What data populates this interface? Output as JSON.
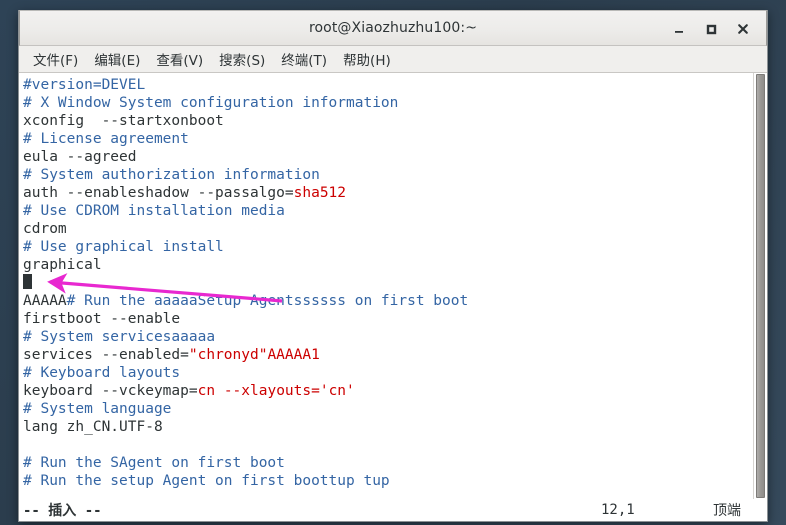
{
  "window": {
    "title": "root@Xiaozhuzhu100:~",
    "controls": [
      {
        "name": "minimize-button",
        "glyph": "minimize"
      },
      {
        "name": "maximize-button",
        "glyph": "maximize"
      },
      {
        "name": "close-button",
        "glyph": "close"
      }
    ]
  },
  "menubar": {
    "items": [
      {
        "label": "文件(F)"
      },
      {
        "label": "编辑(E)"
      },
      {
        "label": "查看(V)"
      },
      {
        "label": "搜索(S)"
      },
      {
        "label": "终端(T)"
      },
      {
        "label": "帮助(H)"
      }
    ]
  },
  "terminal": {
    "lines": [
      {
        "segments": [
          {
            "text": "#version=DEVEL",
            "style": "cmt"
          }
        ]
      },
      {
        "segments": [
          {
            "text": "# X Window System configuration information",
            "style": "cmt"
          }
        ]
      },
      {
        "segments": [
          {
            "text": "xconfig  --startxonboot",
            "style": "norm"
          }
        ]
      },
      {
        "segments": [
          {
            "text": "# License agreement",
            "style": "cmt"
          }
        ]
      },
      {
        "segments": [
          {
            "text": "eula --agreed",
            "style": "norm"
          }
        ]
      },
      {
        "segments": [
          {
            "text": "# System authorization information",
            "style": "cmt"
          }
        ]
      },
      {
        "segments": [
          {
            "text": "auth --enableshadow --passalgo=",
            "style": "norm"
          },
          {
            "text": "sha512",
            "style": "red"
          }
        ]
      },
      {
        "segments": [
          {
            "text": "# Use CDROM installation media",
            "style": "cmt"
          }
        ]
      },
      {
        "segments": [
          {
            "text": "cdrom",
            "style": "norm"
          }
        ]
      },
      {
        "segments": [
          {
            "text": "# Use graphical install",
            "style": "cmt"
          }
        ]
      },
      {
        "segments": [
          {
            "text": "graphical",
            "style": "norm"
          }
        ]
      },
      {
        "segments": [
          {
            "text": "",
            "style": "cursor"
          }
        ]
      },
      {
        "segments": [
          {
            "text": "AAAAA",
            "style": "norm"
          },
          {
            "text": "# Run the aaaaaSetup Agentssssss on first boot",
            "style": "cmt"
          }
        ]
      },
      {
        "segments": [
          {
            "text": "firstboot --enable",
            "style": "norm"
          }
        ]
      },
      {
        "segments": [
          {
            "text": "# System servicesaaaaa",
            "style": "cmt"
          }
        ]
      },
      {
        "segments": [
          {
            "text": "services --enabled=",
            "style": "norm"
          },
          {
            "text": "\"chronyd\"AAAAA1",
            "style": "red"
          }
        ]
      },
      {
        "segments": [
          {
            "text": "# Keyboard layouts",
            "style": "cmt"
          }
        ]
      },
      {
        "segments": [
          {
            "text": "keyboard --vckeymap=",
            "style": "norm"
          },
          {
            "text": "cn",
            "style": "red"
          },
          {
            "text": " ",
            "style": "norm"
          },
          {
            "text": "--xlayouts='cn'",
            "style": "red"
          }
        ]
      },
      {
        "segments": [
          {
            "text": "# System language",
            "style": "cmt"
          }
        ]
      },
      {
        "segments": [
          {
            "text": "lang zh_CN.UTF-8",
            "style": "norm"
          }
        ]
      },
      {
        "segments": [
          {
            "text": "",
            "style": "norm"
          }
        ]
      },
      {
        "segments": [
          {
            "text": "# Run the SAgent on first boot",
            "style": "cmt"
          }
        ]
      },
      {
        "segments": [
          {
            "text": "# Run the setup Agent on first boottup tup",
            "style": "cmt"
          }
        ]
      }
    ]
  },
  "statusline": {
    "mode": "-- 插入 --",
    "position": "12,1",
    "location": "顶端"
  },
  "annotation": {
    "arrow_color": "#e828d0"
  },
  "colors": {
    "comment_blue": "#3465a4",
    "value_red": "#cc0000",
    "text": "#2e3436",
    "terminal_bg": "#ffffff",
    "desktop_bg": "#2e4356"
  }
}
